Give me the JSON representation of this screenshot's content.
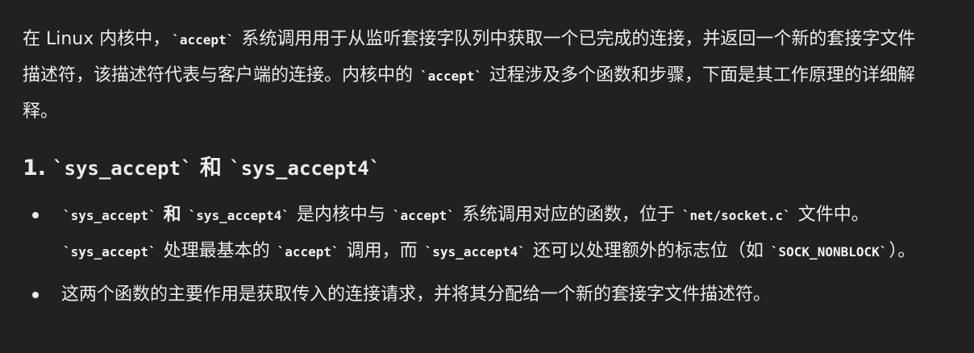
{
  "intro": {
    "p1": "在 Linux 内核中，",
    "code1": "`accept`",
    "p2": " 系统调用用于从监听套接字队列中获取一个已完成的连接，并返回一个新的套接字文件描述符，该描述符代表与客户端的连接。内核中的 ",
    "code2": "`accept`",
    "p3": " 过程涉及多个函数和步骤，下面是其工作原理的详细解释。"
  },
  "heading": {
    "number": "1.",
    "code1": "`sys_accept`",
    "and": "和",
    "code2": "`sys_accept4`"
  },
  "bullets": [
    {
      "code1": "`sys_accept`",
      "and": "和",
      "code2": "`sys_accept4`",
      "t1": " 是内核中与 ",
      "code3": "`accept`",
      "t2": " 系统调用对应的函数，位于 ",
      "code4": "`net/socket.c`",
      "t3": " 文件中。",
      "code5": "`sys_accept`",
      "t4": " 处理最基本的 ",
      "code6": "`accept`",
      "t5": " 调用，而 ",
      "code7": "`sys_accept4`",
      "t6": " 还可以处理额外的标志位（如 ",
      "code8": "`SOCK_NONBLOCK`",
      "t7": "）。"
    },
    {
      "text": "这两个函数的主要作用是获取传入的连接请求，并将其分配给一个新的套接字文件描述符。"
    }
  ]
}
